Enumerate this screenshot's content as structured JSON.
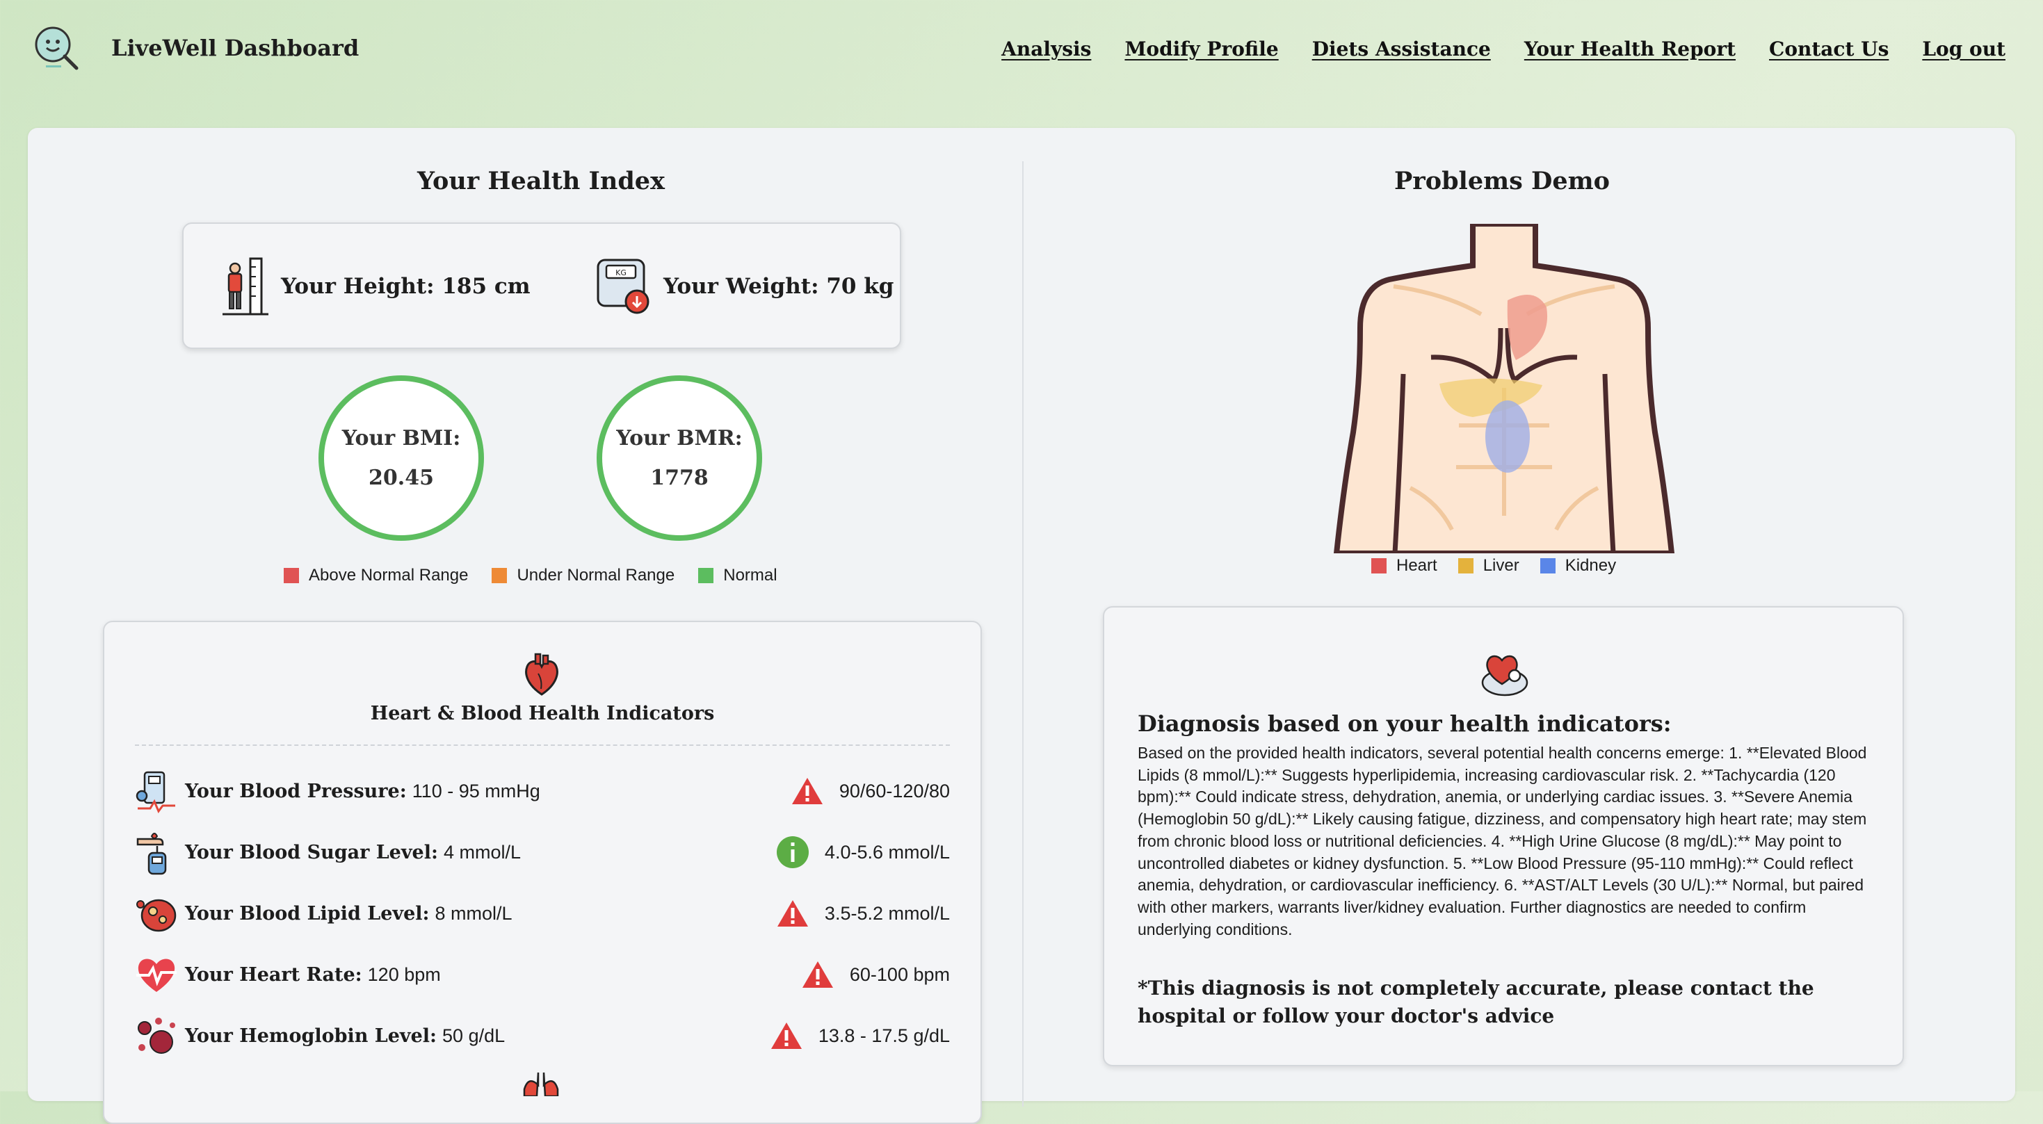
{
  "header": {
    "brand": "LiveWell Dashboard",
    "nav": [
      "Analysis",
      "Modify Profile",
      "Diets Assistance",
      "Your Health Report",
      "Contact Us",
      "Log out"
    ]
  },
  "left": {
    "title": "Your Health Index",
    "height_text": "Your Height: 185 cm",
    "weight_text": "Your Weight: 70 kg",
    "bmi_label": "Your BMI:",
    "bmi_value": "20.45",
    "bmr_label": "Your BMR:",
    "bmr_value": "1778",
    "legend": [
      {
        "label": "Above Normal Range",
        "color": "#e05353"
      },
      {
        "label": "Under Normal Range",
        "color": "#ee8a36"
      },
      {
        "label": "Normal",
        "color": "#5cbd5f"
      }
    ],
    "indicators_title": "Heart & Blood Health Indicators",
    "indicators": [
      {
        "name": "Your Blood Pressure:",
        "value": "110 - 95 mmHg",
        "range": "90/60-120/80",
        "status": "warning",
        "icon": "blood-pressure-icon"
      },
      {
        "name": "Your Blood Sugar Level:",
        "value": "4 mmol/L",
        "range": "4.0-5.6 mmol/L",
        "status": "info",
        "icon": "blood-sugar-icon"
      },
      {
        "name": "Your Blood Lipid Level:",
        "value": "8 mmol/L",
        "range": "3.5-5.2 mmol/L",
        "status": "warning",
        "icon": "blood-lipid-icon"
      },
      {
        "name": "Your Heart Rate:",
        "value": "120 bpm",
        "range": "60-100 bpm",
        "status": "warning",
        "icon": "heart-rate-icon"
      },
      {
        "name": "Your Hemoglobin Level:",
        "value": "50 g/dL",
        "range": "13.8 - 17.5 g/dL",
        "status": "warning",
        "icon": "hemoglobin-icon"
      }
    ]
  },
  "right": {
    "title": "Problems Demo",
    "legend": [
      {
        "label": "Heart",
        "color": "#e05353"
      },
      {
        "label": "Liver",
        "color": "#e4b23c"
      },
      {
        "label": "Kidney",
        "color": "#5a86e8"
      }
    ],
    "diagnosis_title": "Diagnosis based on your health indicators:",
    "diagnosis_text": "Based on the provided health indicators, several potential health concerns emerge: 1. **Elevated Blood Lipids (8 mmol/L):** Suggests hyperlipidemia, increasing cardiovascular risk. 2. **Tachycardia (120 bpm):** Could indicate stress, dehydration, anemia, or underlying cardiac issues. 3. **Severe Anemia (Hemoglobin 50 g/dL):** Likely causing fatigue, dizziness, and compensatory high heart rate; may stem from chronic blood loss or nutritional deficiencies. 4. **High Urine Glucose (8 mg/dL):** May point to uncontrolled diabetes or kidney dysfunction. 5. **Low Blood Pressure (95-110 mmHg):** Could reflect anemia, dehydration, or cardiovascular inefficiency. 6. **AST/ALT Levels (30 U/L):** Normal, but paired with other markers, warrants liver/kidney evaluation. Further diagnostics are needed to confirm underlying conditions.",
    "diagnosis_note": "*This diagnosis is not completely accurate, please contact the hospital or follow your doctor's advice"
  }
}
